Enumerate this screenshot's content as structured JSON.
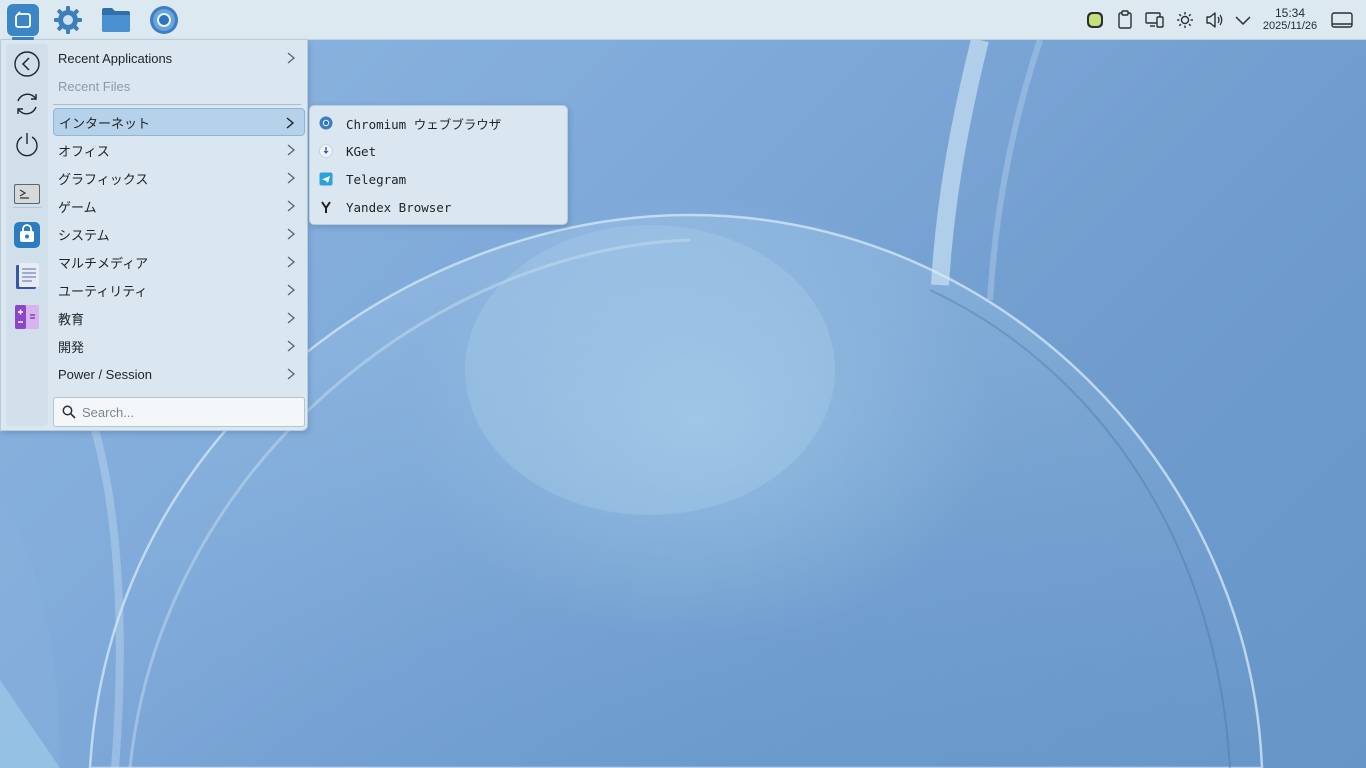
{
  "desktop": {
    "panel": {
      "launchers": [
        {
          "name": "application-launcher",
          "icon": "launcher-icon"
        },
        {
          "name": "system-settings",
          "icon": "gear-icon"
        },
        {
          "name": "file-manager",
          "icon": "folder-icon"
        },
        {
          "name": "chromium",
          "icon": "chromium-icon"
        }
      ],
      "tray": [
        {
          "name": "battery-indicator",
          "icon": "battery-icon"
        },
        {
          "name": "clipboard",
          "icon": "clipboard-icon"
        },
        {
          "name": "display-settings",
          "icon": "display-icon"
        },
        {
          "name": "brightness",
          "icon": "sun-icon"
        },
        {
          "name": "volume",
          "icon": "speaker-icon"
        },
        {
          "name": "tray-expander",
          "icon": "chevron-down-icon"
        }
      ],
      "clock": {
        "time": "15:34",
        "date": "2025/11/26"
      },
      "show_desktop_icon": "show-desktop-icon"
    }
  },
  "menu": {
    "sidebar": [
      {
        "name": "back",
        "icon": "back-arrow-icon"
      },
      {
        "name": "refresh",
        "icon": "refresh-icon"
      },
      {
        "name": "power",
        "icon": "power-icon"
      },
      {
        "name": "terminal",
        "icon": "terminal-icon"
      },
      {
        "name": "software-store",
        "icon": "store-bag-icon"
      },
      {
        "name": "text-editor",
        "icon": "document-icon"
      },
      {
        "name": "calculator",
        "icon": "calculator-icon"
      }
    ],
    "items": [
      {
        "label": "Recent Applications",
        "has_submenu": true
      },
      {
        "label": "Recent Files",
        "has_submenu": false,
        "disabled": true
      },
      {
        "label": "インターネット",
        "has_submenu": true,
        "selected": true
      },
      {
        "label": "オフィス",
        "has_submenu": true
      },
      {
        "label": "グラフィックス",
        "has_submenu": true
      },
      {
        "label": "ゲーム",
        "has_submenu": true
      },
      {
        "label": "システム",
        "has_submenu": true
      },
      {
        "label": "マルチメディア",
        "has_submenu": true
      },
      {
        "label": "ユーティリティ",
        "has_submenu": true
      },
      {
        "label": "教育",
        "has_submenu": true
      },
      {
        "label": "開発",
        "has_submenu": true
      },
      {
        "label": "Power / Session",
        "has_submenu": true
      }
    ],
    "search": {
      "placeholder": "Search..."
    }
  },
  "submenu": {
    "parent": "インターネット",
    "items": [
      {
        "label": "Chromium ウェブブラウザ",
        "icon": "chromium-icon"
      },
      {
        "label": "KGet",
        "icon": "kget-icon"
      },
      {
        "label": "Telegram",
        "icon": "telegram-icon"
      },
      {
        "label": "Yandex Browser",
        "icon": "yandex-icon"
      }
    ]
  },
  "colors": {
    "accent": "#3d86c6",
    "panel_bg": "#dde9f1",
    "menu_bg": "#dae7f0",
    "selection": "#b6d2ea"
  }
}
